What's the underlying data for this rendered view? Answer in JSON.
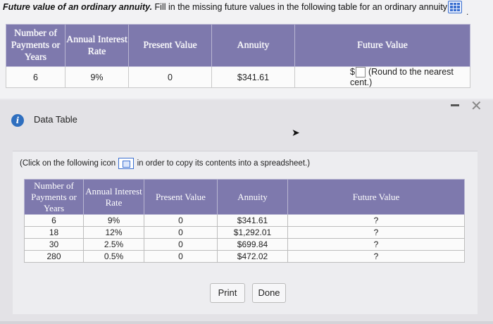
{
  "question": {
    "bold_prefix": "Future value of an ordinary annuity.",
    "text": " Fill in the missing future values in the following table for an ordinary annuity:",
    "icon": "grid-icon",
    "trailing": "."
  },
  "main_table": {
    "headers": [
      "Number of Payments or Years",
      "Annual Interest Rate",
      "Present Value",
      "Annuity",
      "Future Value"
    ],
    "row": {
      "payments": "6",
      "rate": "9%",
      "present_value": "0",
      "annuity": "$341.61",
      "currency_symbol": "$",
      "hint": "(Round to the nearest cent.)"
    }
  },
  "data_table": {
    "title": "Data Table",
    "instruction_prefix": "(Click on the following icon",
    "instruction_suffix": "in order to copy its contents into a spreadsheet.)",
    "headers": [
      "Number of Payments or Years",
      "Annual Interest Rate",
      "Present Value",
      "Annuity",
      "Future Value"
    ],
    "rows": [
      [
        "6",
        "9%",
        "0",
        "$341.61",
        "?"
      ],
      [
        "18",
        "12%",
        "0",
        "$1,292.01",
        "?"
      ],
      [
        "30",
        "2.5%",
        "0",
        "$699.84",
        "?"
      ],
      [
        "280",
        "0.5%",
        "0",
        "$472.02",
        "?"
      ]
    ]
  },
  "buttons": {
    "print": "Print",
    "done": "Done"
  },
  "colors": {
    "header_bg": "#7e79ad",
    "accent_blue": "#3a6fd0",
    "info_blue": "#2f6fbf"
  }
}
